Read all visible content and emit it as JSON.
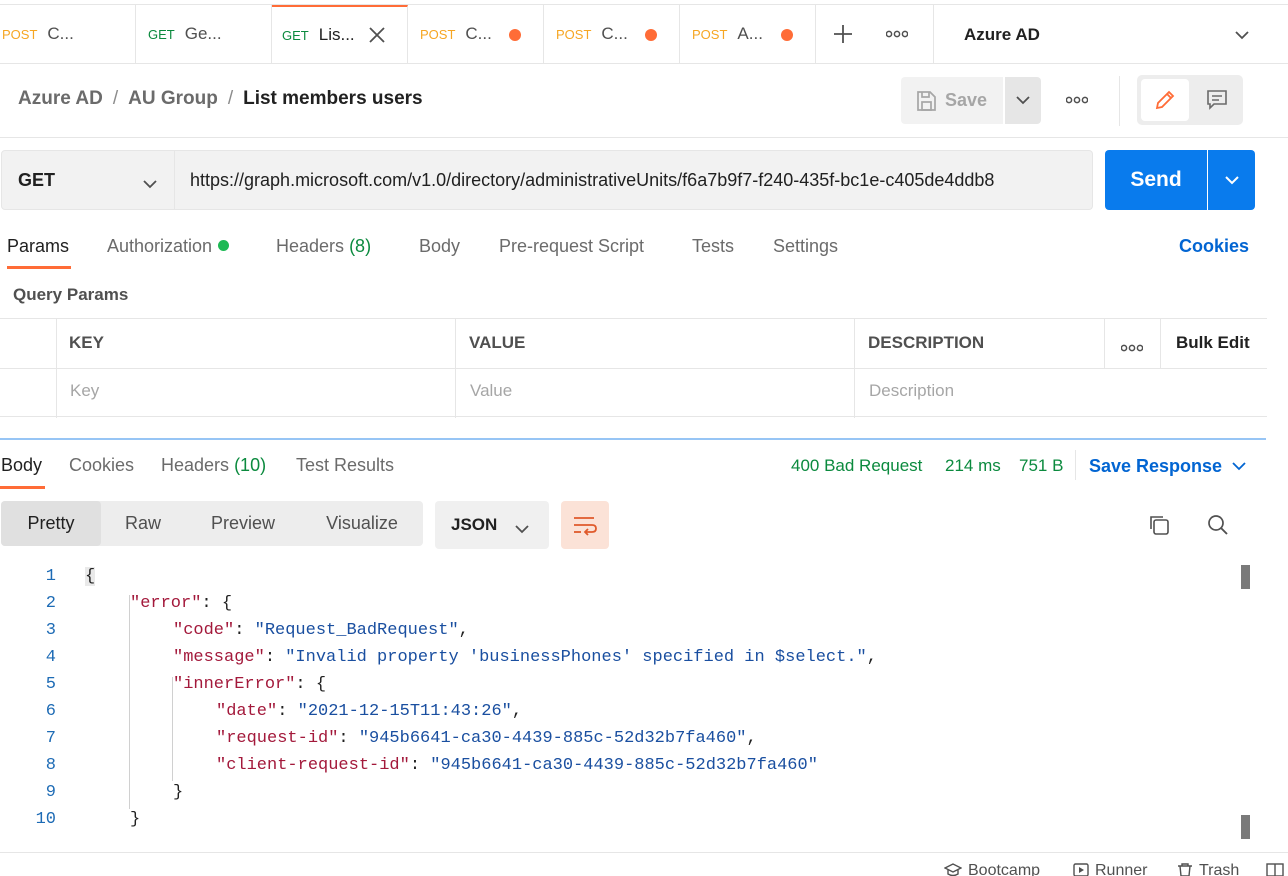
{
  "request_tabs": [
    {
      "method": "POST",
      "name": "C...",
      "unsaved": false
    },
    {
      "method": "GET",
      "name": "Ge...",
      "unsaved": false
    },
    {
      "method": "GET",
      "name": "Lis...",
      "active": true
    },
    {
      "method": "POST",
      "name": "C...",
      "unsaved": true
    },
    {
      "method": "POST",
      "name": "C...",
      "unsaved": true
    },
    {
      "method": "POST",
      "name": "A...",
      "unsaved": true
    }
  ],
  "environment": {
    "name": "Azure AD"
  },
  "breadcrumb": {
    "part1": "Azure AD",
    "part2": "AU Group",
    "current": "List members users",
    "separator": "/"
  },
  "toolbar": {
    "save_label": "Save"
  },
  "request": {
    "method": "GET",
    "url": "https://graph.microsoft.com/v1.0/directory/administrativeUnits/f6a7b9f7-f240-435f-bc1e-c405de4ddb8",
    "send_label": "Send"
  },
  "req_tabs": {
    "params": "Params",
    "authorization": "Authorization",
    "headers": "Headers",
    "headers_count": "(8)",
    "body": "Body",
    "prerequest": "Pre-request Script",
    "tests": "Tests",
    "settings": "Settings",
    "cookies": "Cookies"
  },
  "query_params": {
    "title": "Query Params",
    "columns": {
      "key": "KEY",
      "value": "VALUE",
      "description": "DESCRIPTION"
    },
    "bulk_edit": "Bulk Edit",
    "placeholders": {
      "key": "Key",
      "value": "Value",
      "description": "Description"
    }
  },
  "response": {
    "tabs": {
      "body": "Body",
      "cookies": "Cookies",
      "headers": "Headers",
      "headers_count": "(10)",
      "test_results": "Test Results"
    },
    "status": "400 Bad Request",
    "time": "214 ms",
    "size": "751 B",
    "save_response": "Save Response",
    "views": {
      "pretty": "Pretty",
      "raw": "Raw",
      "preview": "Preview",
      "visualize": "Visualize"
    },
    "format": "JSON"
  },
  "code": {
    "line_numbers": [
      "1",
      "2",
      "3",
      "4",
      "5",
      "6",
      "7",
      "8",
      "9",
      "10"
    ],
    "l1": "{",
    "l2_key": "\"error\"",
    "l2_rest": ": {",
    "l3_key": "\"code\"",
    "l3_val": "\"Request_BadRequest\"",
    "l4_key": "\"message\"",
    "l4_val": "\"Invalid property 'businessPhones' specified in $select.\"",
    "l5_key": "\"innerError\"",
    "l5_rest": ": {",
    "l6_key": "\"date\"",
    "l6_val": "\"2021-12-15T11:43:26\"",
    "l7_key": "\"request-id\"",
    "l7_val": "\"945b6641-ca30-4439-885c-52d32b7fa460\"",
    "l8_key": "\"client-request-id\"",
    "l8_val": "\"945b6641-ca30-4439-885c-52d32b7fa460\"",
    "l9": "}",
    "l10": "}"
  },
  "footer": {
    "bootcamp": "Bootcamp",
    "runner": "Runner",
    "trash": "Trash"
  },
  "colors": {
    "accent": "#ff6c37",
    "send": "#097bed",
    "status_ok_text": "#0b8a3e",
    "link": "#0265d2"
  }
}
